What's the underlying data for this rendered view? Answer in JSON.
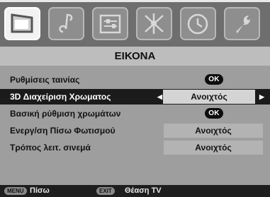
{
  "menu": {
    "title": "ΕΙΚΟΝΑ",
    "items": [
      {
        "label": "Ρυθμίσεις ταινίας",
        "ok": "OK"
      },
      {
        "label": "3D Διαχείριση Χρωματος",
        "value": "Ανοιχτός"
      },
      {
        "label": "Βασική ρύθμιση χρωμάτων",
        "ok": "OK"
      },
      {
        "label": "Ενεργ/ση Πίσω Φωτισμού",
        "value": "Ανοιχτός"
      },
      {
        "label": "Τρόπος λειτ. σινεμά",
        "value": "Ανοιχτός"
      }
    ]
  },
  "tabs": [
    {
      "icon": "picture-icon",
      "active": true
    },
    {
      "icon": "music-note-icon"
    },
    {
      "icon": "sliders-icon"
    },
    {
      "icon": "network-icon"
    },
    {
      "icon": "clock-icon"
    },
    {
      "icon": "wrench-icon"
    }
  ],
  "footer": {
    "menu_key": "MENU",
    "menu_label": "Πίσω",
    "exit_key": "EXIT",
    "exit_label": "Θέαση TV"
  }
}
